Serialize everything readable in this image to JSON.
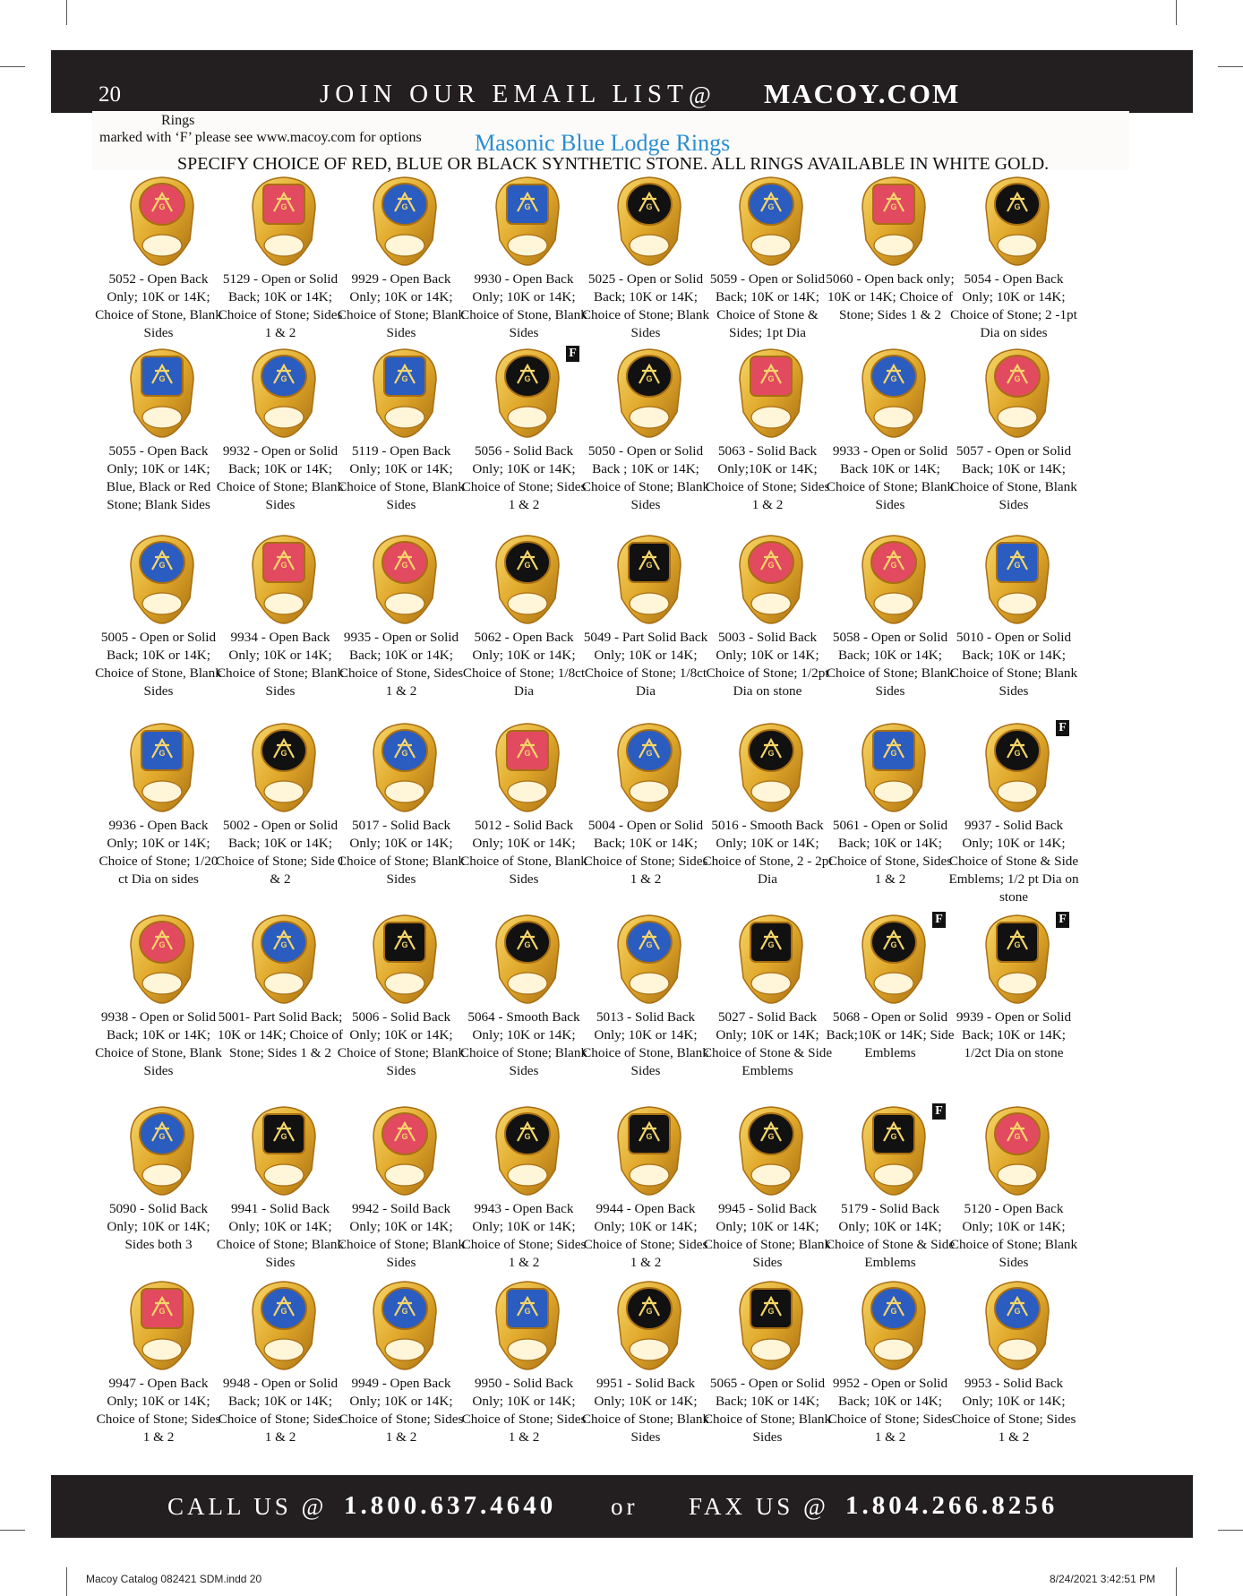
{
  "header": {
    "page_number": "20",
    "email_promo": "JOIN OUR EMAIL LIST",
    "at": "@",
    "site": "MACOY.COM"
  },
  "notes": {
    "rings_word": "Rings",
    "options_note": "marked with ‘F’ please see www.macoy.com for options"
  },
  "section_title": "Masonic Blue Lodge Rings",
  "specify_line": "SPECIFY CHOICE OF RED, BLUE OR BLACK SYNTHETIC STONE.  ALL RINGS AVAILABLE IN WHITE GOLD.",
  "colors": {
    "gold": "#e0a82a",
    "gold_light": "#f6d66a",
    "gold_dark": "#a86e12",
    "red_stone": "#e24a60",
    "blue_stone": "#2b5cc0",
    "black_stone": "#111111",
    "title_blue": "#2a8ed1",
    "bar": "#231f20"
  },
  "f_label": "F",
  "rings": [
    {
      "stone": "red",
      "caption": "5052 - Open Back Only; 10K or 14K; Choice of Stone, Blank Sides"
    },
    {
      "stone": "red",
      "caption": "5129 - Open or Solid Back; 10K or 14K; Choice of Stone; Sides 1 & 2"
    },
    {
      "stone": "blue",
      "caption": "9929 - Open Back Only; 10K or 14K; Choice of Stone; Blank Sides"
    },
    {
      "stone": "blue",
      "caption": "9930 - Open Back Only; 10K or 14K; Choice of Stone, Blank Sides"
    },
    {
      "stone": "black",
      "caption": "5025 - Open or Solid Back; 10K or 14K; Choice of Stone; Blank Sides"
    },
    {
      "stone": "blue",
      "caption": "5059 - Open or Solid Back; 10K or 14K; Choice of Stone & Sides; 1pt Dia"
    },
    {
      "stone": "red",
      "caption": "5060 - Open back only; 10K or 14K; Choice of Stone; Sides 1 & 2"
    },
    {
      "stone": "black",
      "caption": "5054 - Open Back Only; 10K or 14K; Choice of Stone; 2 -1pt Dia on sides"
    },
    {
      "stone": "blue",
      "caption": "5055 - Open Back Only; 10K or 14K; Blue, Black or Red Stone; Blank Sides"
    },
    {
      "stone": "blue",
      "caption": "9932 - Open or Solid Back; 10K or 14K; Choice of Stone; Blank Sides"
    },
    {
      "stone": "blue",
      "caption": "5119 - Open Back Only; 10K or 14K; Choice of Stone, Blank Sides"
    },
    {
      "stone": "black",
      "caption": "5056 - Solid Back Only; 10K or 14K; Choice of Stone; Sides 1 & 2",
      "f": true
    },
    {
      "stone": "black",
      "caption": "5050 - Open  or Solid  Back ; 10K or 14K; Choice of Stone; Blank Sides"
    },
    {
      "stone": "red",
      "caption": "5063 - Solid Back Only;10K or 14K; Choice of Stone; Sides 1 & 2"
    },
    {
      "stone": "blue",
      "caption": "9933 - Open or Solid Back 10K or 14K; Choice of Stone; Blank Sides"
    },
    {
      "stone": "red",
      "caption": "5057 - Open  or Solid Back; 10K or 14K; Choice of Stone, Blank Sides"
    },
    {
      "stone": "blue",
      "caption": "5005 - Open or Solid Back; 10K or 14K; Choice of Stone, Blank Sides"
    },
    {
      "stone": "red",
      "caption": "9934 - Open Back Only; 10K or 14K; Choice of Stone; Blank Sides"
    },
    {
      "stone": "red",
      "caption": "9935 - Open or Solid Back; 10K or 14K; Choice of Stone, Sides 1 & 2"
    },
    {
      "stone": "black",
      "caption": "5062 - Open Back Only; 10K or 14K; Choice of Stone; 1/8ct Dia"
    },
    {
      "stone": "black",
      "caption": "5049 - Part Solid Back Only; 10K or 14K; Choice of Stone; 1/8ct Dia"
    },
    {
      "stone": "red",
      "caption": "5003 - Solid Back Only; 10K or 14K; Choice of Stone; 1/2pt Dia on stone"
    },
    {
      "stone": "red",
      "caption": "5058 - Open or Solid Back; 10K or 14K; Choice of Stone; Blank Sides"
    },
    {
      "stone": "blue",
      "caption": "5010 - Open or Solid Back; 10K or 14K; Choice of Stone; Blank Sides"
    },
    {
      "stone": "blue",
      "caption": "9936 - Open Back Only; 10K or 14K; Choice of Stone; 1/20 ct Dia on sides"
    },
    {
      "stone": "black",
      "caption": "5002 - Open or Solid Back; 10K or 14K; Choice of Stone; Side 1 & 2"
    },
    {
      "stone": "blue",
      "caption": "5017 - Solid Back Only; 10K or 14K; Choice of Stone; Blank Sides"
    },
    {
      "stone": "red",
      "caption": "5012 - Solid Back Only; 10K or 14K; Choice of Stone, Blank Sides"
    },
    {
      "stone": "blue",
      "caption": "5004 - Open or Solid Back; 10K or 14K; Choice of Stone; Sides 1 & 2"
    },
    {
      "stone": "black",
      "caption": "5016 - Smooth Back Only; 10K or 14K; Choice of Stone, 2 - 2pt Dia"
    },
    {
      "stone": "blue",
      "caption": "5061 - Open or Solid Back; 10K or 14K; Choice of Stone, Sides 1 & 2"
    },
    {
      "stone": "black",
      "caption": "9937 - Solid Back Only; 10K or 14K; Choice of Stone & Side Emblems; 1/2 pt Dia on stone",
      "f": true
    },
    {
      "stone": "red",
      "caption": "9938 - Open or Solid Back; 10K or 14K; Choice of Stone, Blank Sides"
    },
    {
      "stone": "blue",
      "caption": "5001- Part Solid Back; 10K or 14K; Choice of Stone; Sides 1 & 2"
    },
    {
      "stone": "black",
      "caption": "5006 - Solid Back Only; 10K or 14K; Choice of Stone; Blank Sides"
    },
    {
      "stone": "black",
      "caption": "5064 - Smooth Back Only; 10K or 14K; Choice of Stone; Blank Sides"
    },
    {
      "stone": "blue",
      "caption": "5013 - Solid Back Only; 10K or 14K; Choice of Stone, Blank Sides"
    },
    {
      "stone": "black",
      "caption": "5027 - Solid Back Only; 10K or 14K; Choice of Stone & Side Emblems"
    },
    {
      "stone": "black",
      "caption": "5068 - Open or Solid Back;10K or 14K; Side Emblems",
      "f": true
    },
    {
      "stone": "black",
      "caption": "9939 - Open or Solid Back; 10K or 14K; 1/2ct Dia on stone",
      "f": true
    },
    {
      "stone": "blue",
      "caption": "5090 - Solid Back Only; 10K or 14K; Sides both 3"
    },
    {
      "stone": "black",
      "caption": "9941 - Solid Back Only; 10K or 14K; Choice of Stone; Blank Sides"
    },
    {
      "stone": "red",
      "caption": "9942 - Soild Back Only; 10K or 14K; Choice of Stone; Blank Sides"
    },
    {
      "stone": "black",
      "caption": "9943 - Open Back Only; 10K or 14K; Choice of Stone; Sides 1 & 2"
    },
    {
      "stone": "black",
      "caption": "9944 - Open Back Only; 10K or 14K; Choice of Stone; Sides 1 & 2"
    },
    {
      "stone": "black",
      "caption": "9945 - Solid Back Only; 10K or 14K; Choice of Stone; Blank Sides"
    },
    {
      "stone": "black",
      "caption": "5179 - Solid Back Only; 10K or 14K; Choice of Stone & Side Emblems",
      "f": true
    },
    {
      "stone": "red",
      "caption": "5120 - Open Back Only; 10K or 14K; Choice of Stone; Blank Sides"
    },
    {
      "stone": "red",
      "caption": "9947 - Open Back Only; 10K or 14K; Choice of Stone; Sides 1 & 2"
    },
    {
      "stone": "blue",
      "caption": "9948 - Open or Solid Back; 10K or 14K; Choice of Stone; Sides 1 & 2"
    },
    {
      "stone": "blue",
      "caption": "9949 - Open Back Only; 10K or 14K; Choice of Stone; Sides 1 & 2"
    },
    {
      "stone": "blue",
      "caption": "9950 - Solid Back Only; 10K or 14K; Choice of Stone; Sides 1 & 2"
    },
    {
      "stone": "black",
      "caption": "9951 - Solid Back Only; 10K or 14K; Choice of Stone; Blank Sides"
    },
    {
      "stone": "black",
      "caption": "5065 - Open or Solid Back; 10K or 14K; Choice of Stone; Blank Sides"
    },
    {
      "stone": "blue",
      "caption": "9952 - Open or Solid Back; 10K or 14K; Choice of Stone; Sides 1 & 2"
    },
    {
      "stone": "blue",
      "caption": "9953 - Solid Back Only; 10K or 14K; Choice of Stone; Sides 1 & 2"
    }
  ],
  "footer": {
    "call_label": "CALL  US @",
    "phone": "1.800.637.4640",
    "or_word": "or",
    "fax_label": "FAX  US @",
    "fax": "1.804.266.8256"
  },
  "slug": {
    "file": "Macoy Catalog  082421 SDM.indd  20",
    "timestamp": "8/24/2021  3:42:51 PM"
  }
}
